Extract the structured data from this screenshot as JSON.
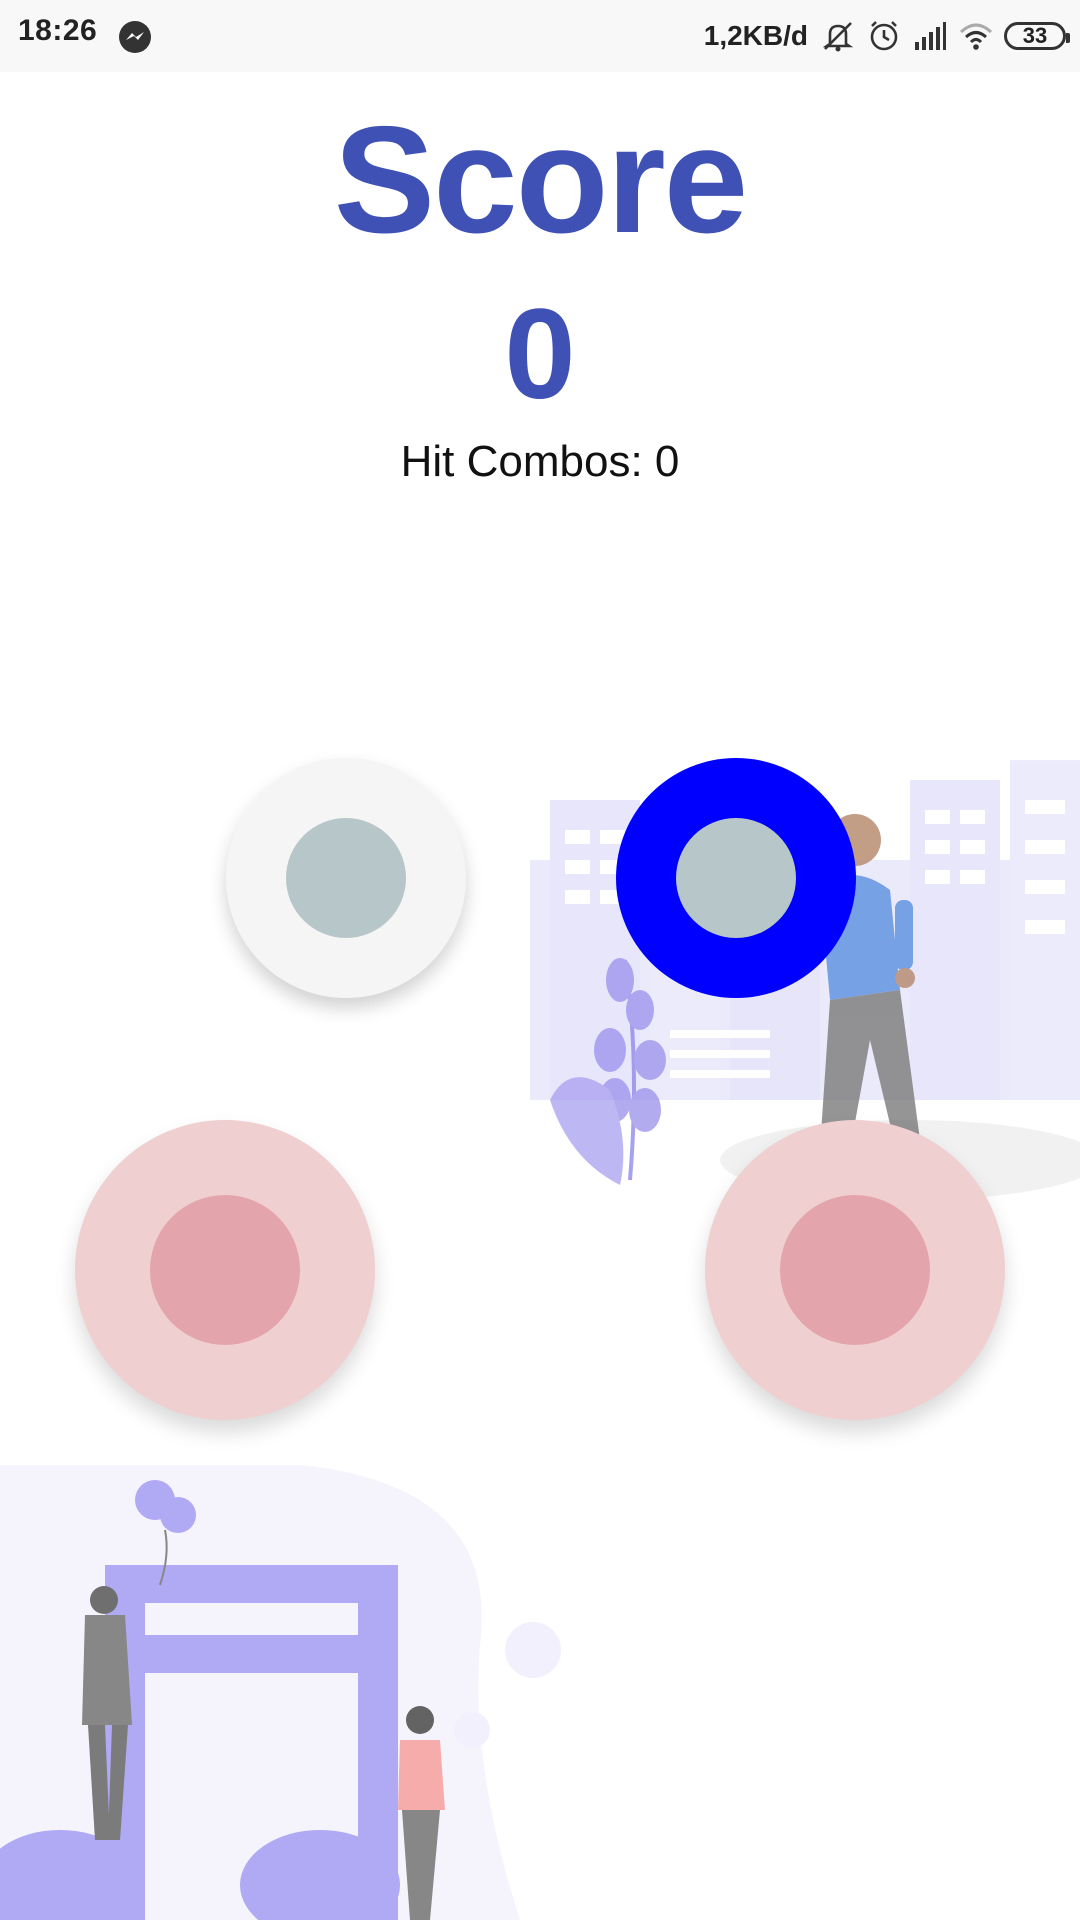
{
  "status_bar": {
    "time": "18:26",
    "network_speed": "1,2KB/d",
    "battery_level": "33",
    "icons": [
      "messenger-icon",
      "mute-icon",
      "alarm-icon",
      "signal-icon",
      "wifi-icon",
      "battery-icon"
    ]
  },
  "score": {
    "title": "Score",
    "value": "0",
    "hit_combos": "Hit Combos: 0"
  },
  "pads": [
    {
      "name": "pad-top-left",
      "state": "idle"
    },
    {
      "name": "pad-top-right",
      "state": "active"
    },
    {
      "name": "pad-bottom-left",
      "state": "idle"
    },
    {
      "name": "pad-bottom-right",
      "state": "idle"
    }
  ],
  "colors": {
    "primary": "#3f51b5",
    "active_pad": "#0000ff",
    "pad_core": "#b7c6c8",
    "red_pad": "#efcfd0",
    "red_pad_core": "#e3a5ab"
  }
}
